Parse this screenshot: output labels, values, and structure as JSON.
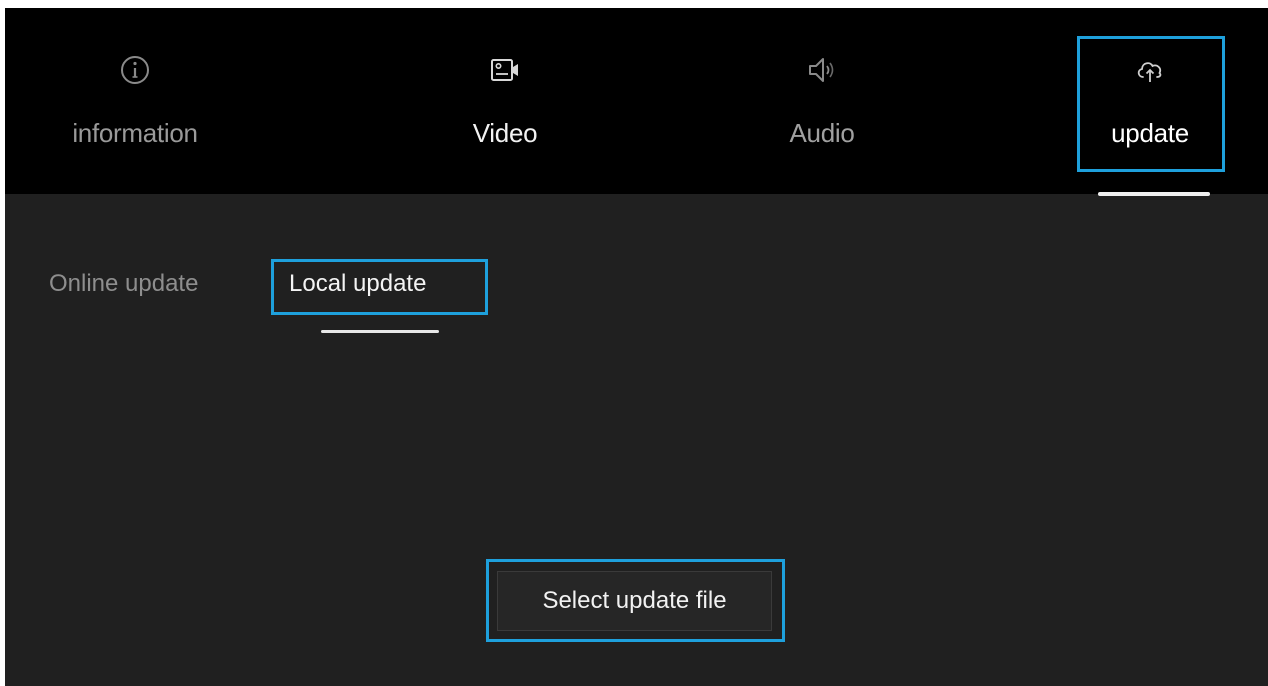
{
  "top_tabs": [
    {
      "label": "information",
      "icon": "info-icon",
      "state": "inactive"
    },
    {
      "label": "Video",
      "icon": "video-camera-icon",
      "state": "inactive"
    },
    {
      "label": "Audio",
      "icon": "speaker-icon",
      "state": "inactive"
    },
    {
      "label": "update",
      "icon": "cloud-upload-icon",
      "state": "selected"
    }
  ],
  "sub_tabs": [
    {
      "label": "Online update",
      "state": "inactive"
    },
    {
      "label": "Local update",
      "state": "selected"
    }
  ],
  "actions": {
    "select_file_label": "Select update file"
  },
  "colors": {
    "top_bar_background": "#000000",
    "content_background": "#202020",
    "highlight": "#1ea0dc",
    "active_text": "#ffffff",
    "inactive_text": "#9a9a9a"
  }
}
